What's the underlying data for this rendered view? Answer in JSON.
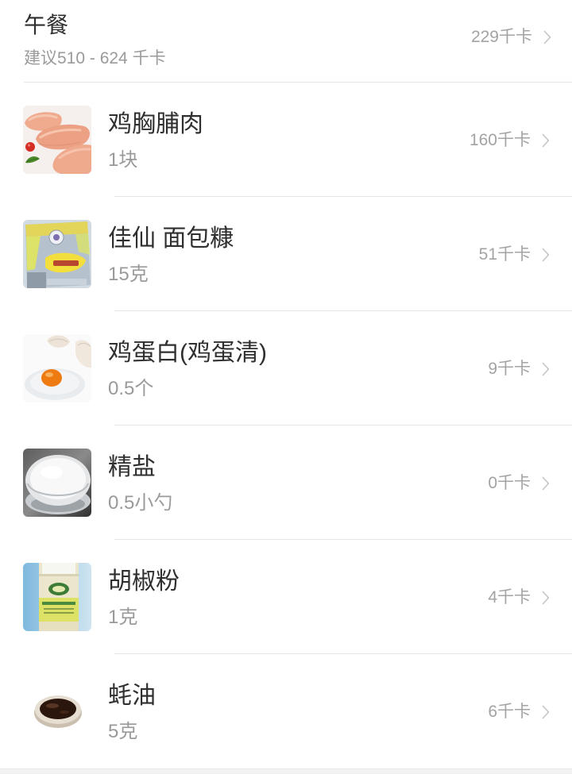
{
  "meal": {
    "title": "午餐",
    "suggestion": "建议510 - 624 千卡",
    "total": "229千卡"
  },
  "items": [
    {
      "name": "鸡胸脯肉",
      "amount": "1块",
      "calories": "160千卡",
      "icon": "chicken-breast-photo"
    },
    {
      "name": "佳仙 面包糠",
      "amount": "15克",
      "calories": "51千卡",
      "icon": "bread-crumbs-package-photo"
    },
    {
      "name": "鸡蛋白(鸡蛋清)",
      "amount": "0.5个",
      "calories": "9千卡",
      "icon": "egg-white-photo"
    },
    {
      "name": "精盐",
      "amount": "0.5小勺",
      "calories": "0千卡",
      "icon": "salt-bowl-photo"
    },
    {
      "name": "胡椒粉",
      "amount": "1克",
      "calories": "4千卡",
      "icon": "pepper-bottle-photo"
    },
    {
      "name": "蚝油",
      "amount": "5克",
      "calories": "6千卡",
      "icon": "oyster-sauce-dish-photo"
    }
  ],
  "icons": {
    "row_chevron": "chevron-right-icon"
  },
  "theme": {
    "text_primary": "#2f2f2f",
    "text_secondary": "#9a9a9a",
    "chevron": "#c4c4c4",
    "divider": "#e6e6e6",
    "footer_bg": "#f2f2f2"
  }
}
